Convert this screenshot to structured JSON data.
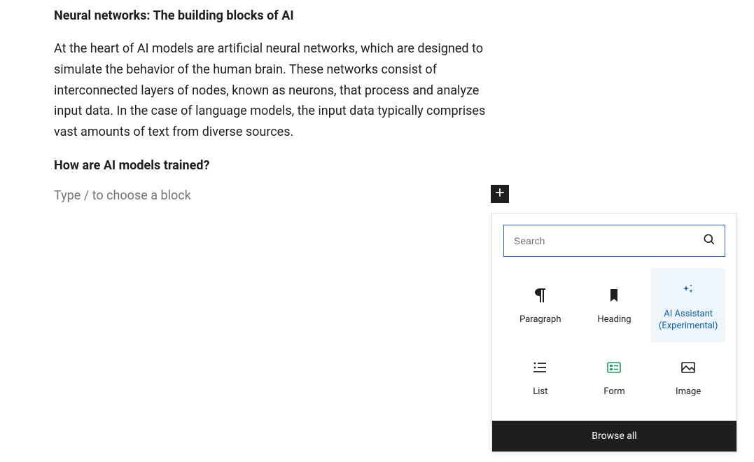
{
  "content": {
    "heading1": "Neural networks: The building blocks of AI",
    "paragraph1": "At the heart of AI models are artificial neural networks, which are designed to simulate the behavior of the human brain. These networks consist of interconnected layers of nodes, known as neurons, that process and analyze input data. In the case of language models, the input data typically comprises vast amounts of text from diverse sources.",
    "heading2": "How are AI models trained?",
    "empty_placeholder": "Type / to choose a block"
  },
  "inserter": {
    "search_placeholder": "Search",
    "blocks": {
      "paragraph": "Paragraph",
      "heading": "Heading",
      "ai_assistant": "AI Assistant (Experimental)",
      "list": "List",
      "form": "Form",
      "image": "Image"
    },
    "browse_all": "Browse all"
  }
}
